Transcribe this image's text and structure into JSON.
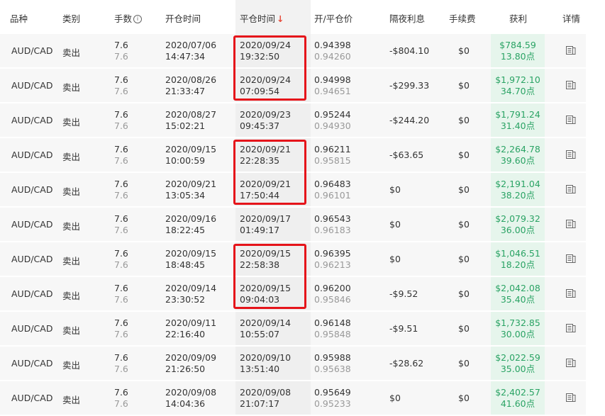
{
  "header": {
    "symbol": "品种",
    "type": "类别",
    "lots": "手数",
    "lots_icon": "info-icon",
    "open_time": "开仓时间",
    "close_time": "平仓时间",
    "close_time_sort_icon": "arrow-down-icon",
    "price": "开/平仓价",
    "swap": "隔夜利息",
    "fee": "手续费",
    "profit": "获利",
    "detail": "详情"
  },
  "colors": {
    "profit": "#2aa364",
    "highlight": "#e5141a",
    "sort_arrow": "#e64b3b"
  },
  "highlight_groups": [
    [
      0,
      1
    ],
    [
      3,
      4
    ],
    [
      6,
      7
    ]
  ],
  "rows": [
    {
      "symbol": "AUD/CAD",
      "type": "卖出",
      "lots": "7.6",
      "lots2": "7.6",
      "open_date": "2020/07/06",
      "open_time": "14:47:34",
      "close_date": "2020/09/24",
      "close_time": "19:32:50",
      "open_price": "0.94398",
      "close_price": "0.94260",
      "swap": "-$804.10",
      "fee": "$0",
      "profit": "$784.59",
      "points": "13.80点"
    },
    {
      "symbol": "AUD/CAD",
      "type": "卖出",
      "lots": "7.6",
      "lots2": "7.6",
      "open_date": "2020/08/26",
      "open_time": "21:33:47",
      "close_date": "2020/09/24",
      "close_time": "07:09:54",
      "open_price": "0.94998",
      "close_price": "0.94651",
      "swap": "-$299.33",
      "fee": "$0",
      "profit": "$1,972.10",
      "points": "34.70点"
    },
    {
      "symbol": "AUD/CAD",
      "type": "卖出",
      "lots": "7.6",
      "lots2": "7.6",
      "open_date": "2020/08/27",
      "open_time": "15:02:21",
      "close_date": "2020/09/23",
      "close_time": "09:45:37",
      "open_price": "0.95244",
      "close_price": "0.94930",
      "swap": "-$244.20",
      "fee": "$0",
      "profit": "$1,791.24",
      "points": "31.40点"
    },
    {
      "symbol": "AUD/CAD",
      "type": "卖出",
      "lots": "7.6",
      "lots2": "7.6",
      "open_date": "2020/09/15",
      "open_time": "10:00:59",
      "close_date": "2020/09/21",
      "close_time": "22:28:35",
      "open_price": "0.96211",
      "close_price": "0.95815",
      "swap": "-$63.65",
      "fee": "$0",
      "profit": "$2,264.78",
      "points": "39.60点"
    },
    {
      "symbol": "AUD/CAD",
      "type": "卖出",
      "lots": "7.6",
      "lots2": "7.6",
      "open_date": "2020/09/21",
      "open_time": "13:05:34",
      "close_date": "2020/09/21",
      "close_time": "17:50:44",
      "open_price": "0.96483",
      "close_price": "0.96101",
      "swap": "$0",
      "fee": "$0",
      "profit": "$2,191.04",
      "points": "38.20点"
    },
    {
      "symbol": "AUD/CAD",
      "type": "卖出",
      "lots": "7.6",
      "lots2": "7.6",
      "open_date": "2020/09/16",
      "open_time": "18:22:45",
      "close_date": "2020/09/17",
      "close_time": "01:49:17",
      "open_price": "0.96543",
      "close_price": "0.96183",
      "swap": "$0",
      "fee": "$0",
      "profit": "$2,079.32",
      "points": "36.00点"
    },
    {
      "symbol": "AUD/CAD",
      "type": "卖出",
      "lots": "7.6",
      "lots2": "7.6",
      "open_date": "2020/09/15",
      "open_time": "18:48:45",
      "close_date": "2020/09/15",
      "close_time": "22:58:38",
      "open_price": "0.96395",
      "close_price": "0.96213",
      "swap": "$0",
      "fee": "$0",
      "profit": "$1,046.51",
      "points": "18.20点"
    },
    {
      "symbol": "AUD/CAD",
      "type": "卖出",
      "lots": "7.6",
      "lots2": "7.6",
      "open_date": "2020/09/14",
      "open_time": "23:30:52",
      "close_date": "2020/09/15",
      "close_time": "09:04:03",
      "open_price": "0.96200",
      "close_price": "0.95846",
      "swap": "-$9.52",
      "fee": "$0",
      "profit": "$2,042.08",
      "points": "35.40点"
    },
    {
      "symbol": "AUD/CAD",
      "type": "卖出",
      "lots": "7.6",
      "lots2": "7.6",
      "open_date": "2020/09/11",
      "open_time": "22:16:40",
      "close_date": "2020/09/14",
      "close_time": "10:55:07",
      "open_price": "0.96148",
      "close_price": "0.95848",
      "swap": "-$9.51",
      "fee": "$0",
      "profit": "$1,732.85",
      "points": "30.00点"
    },
    {
      "symbol": "AUD/CAD",
      "type": "卖出",
      "lots": "7.6",
      "lots2": "7.6",
      "open_date": "2020/09/09",
      "open_time": "21:26:50",
      "close_date": "2020/09/10",
      "close_time": "13:51:40",
      "open_price": "0.95988",
      "close_price": "0.95638",
      "swap": "-$28.62",
      "fee": "$0",
      "profit": "$2,022.59",
      "points": "35.00点"
    },
    {
      "symbol": "AUD/CAD",
      "type": "卖出",
      "lots": "7.6",
      "lots2": "7.6",
      "open_date": "2020/09/08",
      "open_time": "14:04:36",
      "close_date": "2020/09/08",
      "close_time": "21:07:17",
      "open_price": "0.95649",
      "close_price": "0.95233",
      "swap": "$0",
      "fee": "$0",
      "profit": "$2,402.57",
      "points": "41.60点"
    }
  ]
}
